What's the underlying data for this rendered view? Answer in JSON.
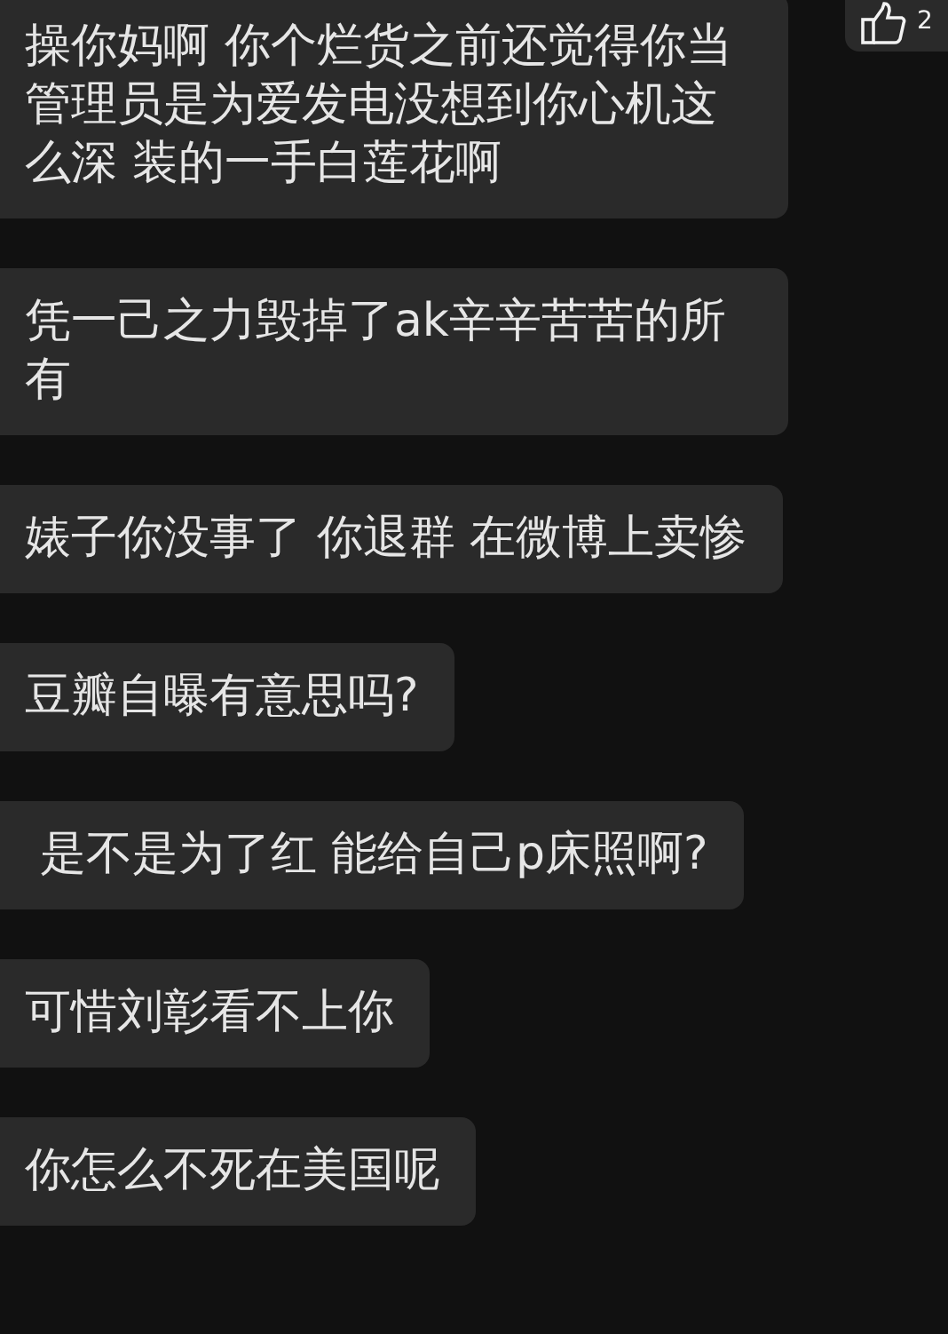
{
  "messages": [
    {
      "text": "操你妈啊 你个烂货之前还觉得你当管理员是为爱发电没想到你心机这么深 装的一手白莲花啊"
    },
    {
      "text": "凭一己之力毁掉了ak辛辛苦苦的所有"
    },
    {
      "text": "婊子你没事了 你退群 在微博上卖惨"
    },
    {
      "text": "豆瓣自曝有意思吗?"
    },
    {
      "text": " 是不是为了红 能给自己p床照啊?"
    },
    {
      "text": "可惜刘彰看不上你"
    },
    {
      "text": "你怎么不死在美国呢"
    }
  ],
  "like_badge": {
    "count": "2"
  }
}
